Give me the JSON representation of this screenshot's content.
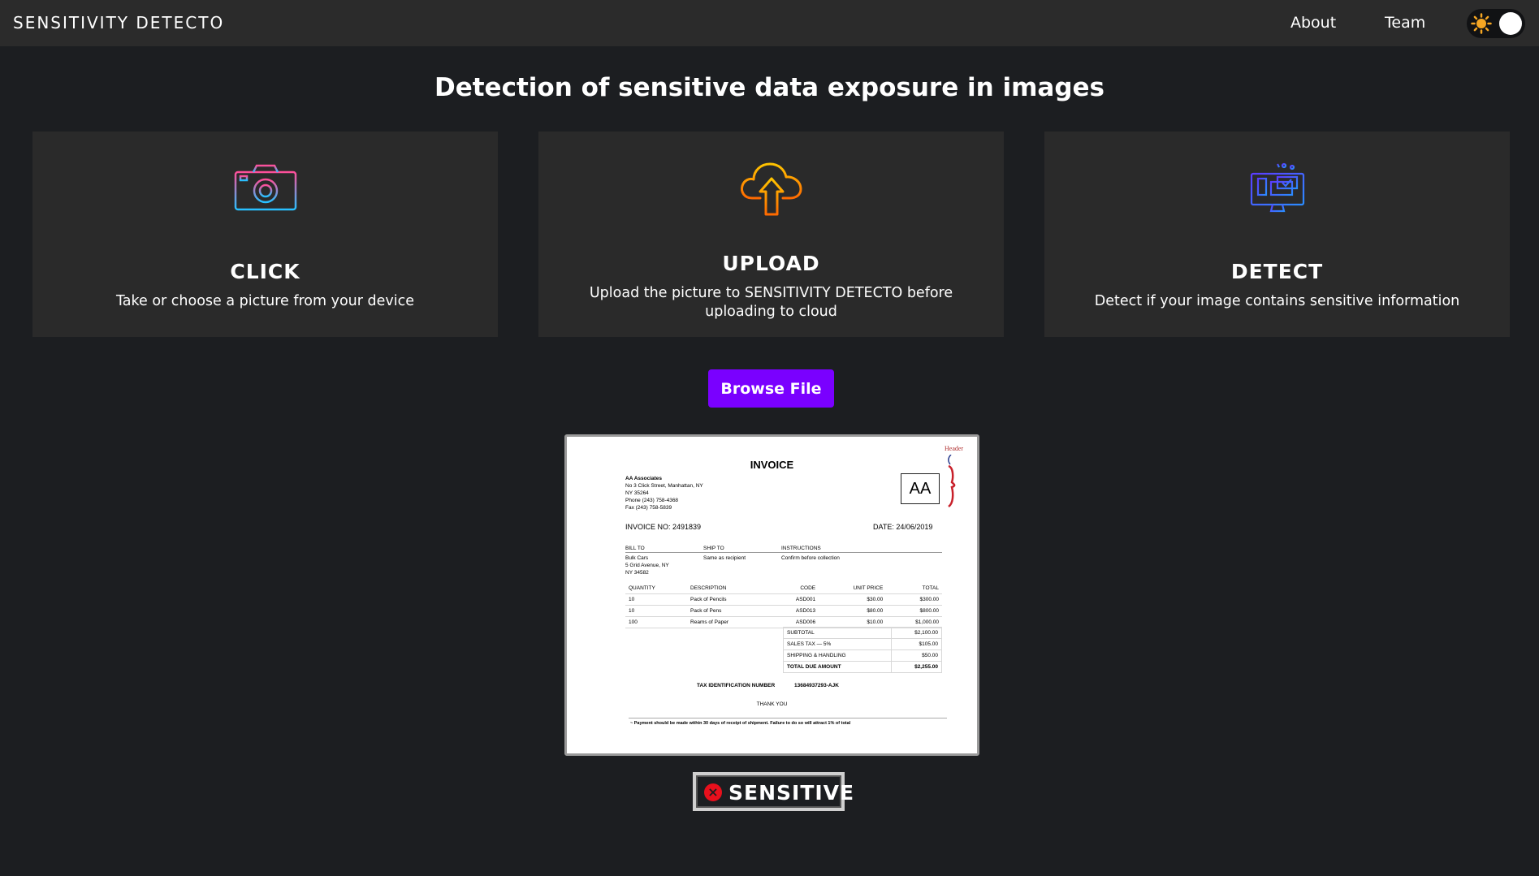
{
  "nav": {
    "brand": "SENSITIVITY DETECTO",
    "links": [
      "About",
      "Team"
    ],
    "theme_toggle_icon": "sun-icon"
  },
  "headline": "Detection of sensitive data exposure in images",
  "cards": [
    {
      "title": "CLICK",
      "desc": "Take or choose a picture from your device",
      "icon": "camera-icon"
    },
    {
      "title": "UPLOAD",
      "desc": "Upload the picture to SENSITIVITY DETECTO before uploading to cloud",
      "icon": "cloud-upload-icon"
    },
    {
      "title": "DETECT",
      "desc": "Detect if your image contains sensitive information",
      "icon": "monitor-detect-icon"
    }
  ],
  "browse_label": "Browse File",
  "preview": {
    "title": "INVOICE",
    "header_note": "Header",
    "logo": "AA",
    "company": "AA Associates",
    "address_lines": [
      "No 3 Click Street, Manhattan, NY",
      "NY 35264"
    ],
    "phone": "Phone (243) 758-4368",
    "fax": "Fax (243) 758-5839",
    "invoice_no": "INVOICE NO: 2491839",
    "date": "DATE: 24/06/2019",
    "bill_to_label": "BILL TO",
    "ship_to_label": "SHIP TO",
    "instructions_label": "INSTRUCTIONS",
    "bill_to": [
      "Bulk Cars",
      "5 Grid Avenue, NY",
      "NY 34582"
    ],
    "ship_to": "Same as recipient",
    "instructions": "Confirm before collection",
    "columns": [
      "QUANTITY",
      "DESCRIPTION",
      "CODE",
      "UNIT PRICE",
      "TOTAL"
    ],
    "rows": [
      [
        "10",
        "Pack of Pencils",
        "ASD001",
        "$30.00",
        "$300.00"
      ],
      [
        "10",
        "Pack of Pens",
        "ASD013",
        "$80.00",
        "$800.00"
      ],
      [
        "100",
        "Reams of Paper",
        "ASD006",
        "$10.00",
        "$1,000.00"
      ]
    ],
    "totals": [
      [
        "SUBTOTAL",
        "$2,100.00"
      ],
      [
        "SALES TAX — 5%",
        "$105.00"
      ],
      [
        "SHIPPING & HANDLING",
        "$50.00"
      ],
      [
        "TOTAL DUE AMOUNT",
        "$2,255.00"
      ]
    ],
    "tax_id_label": "TAX IDENTIFICATION NUMBER",
    "tax_id": "13684937293-AJK",
    "thanks": "THANK YOU",
    "footer": "~ Payment should be made within 30 days of receipt of shipment. Failure to do so will attract 1% of total"
  },
  "result": {
    "label": "SENSITIVE",
    "status_color": "#e8101c",
    "icon": "x-circle-icon"
  },
  "colors": {
    "accent": "#7a00ff",
    "background": "#1c1e21",
    "card": "#2a2a2a"
  }
}
